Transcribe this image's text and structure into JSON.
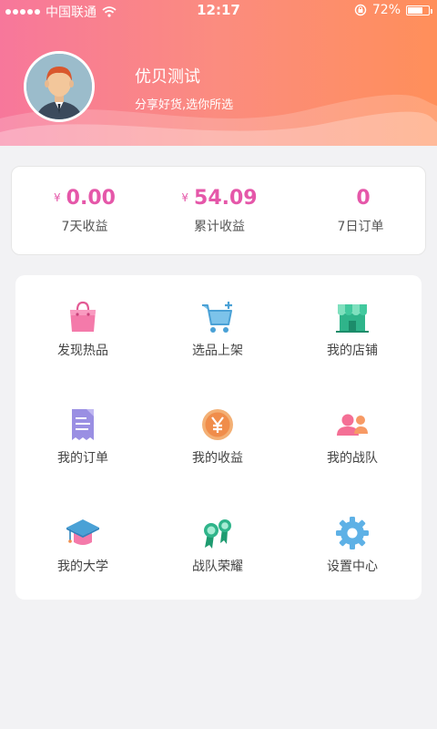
{
  "status": {
    "carrier": "中国联通",
    "time": "12:17",
    "battery": "72%",
    "battery_level": 0.72
  },
  "profile": {
    "name": "优贝测试",
    "tagline": "分享好货,选你所选"
  },
  "stats": [
    {
      "currency": "¥",
      "value": "0.00",
      "label": "7天收益"
    },
    {
      "currency": "¥",
      "value": "54.09",
      "label": "累计收益"
    },
    {
      "currency": "",
      "value": "0",
      "label": "7日订单"
    }
  ],
  "menu": [
    {
      "label": "发现热品",
      "icon": "shopping-bag-icon"
    },
    {
      "label": "选品上架",
      "icon": "cart-add-icon"
    },
    {
      "label": "我的店铺",
      "icon": "store-icon"
    },
    {
      "label": "我的订单",
      "icon": "receipt-icon"
    },
    {
      "label": "我的收益",
      "icon": "yen-coin-icon"
    },
    {
      "label": "我的战队",
      "icon": "team-icon"
    },
    {
      "label": "我的大学",
      "icon": "graduation-cap-icon"
    },
    {
      "label": "战队荣耀",
      "icon": "award-ribbon-icon"
    },
    {
      "label": "设置中心",
      "icon": "gear-icon"
    }
  ],
  "colors": {
    "accent": "#e557a9",
    "header_start": "#f7779b",
    "header_end": "#ff8f5a"
  }
}
